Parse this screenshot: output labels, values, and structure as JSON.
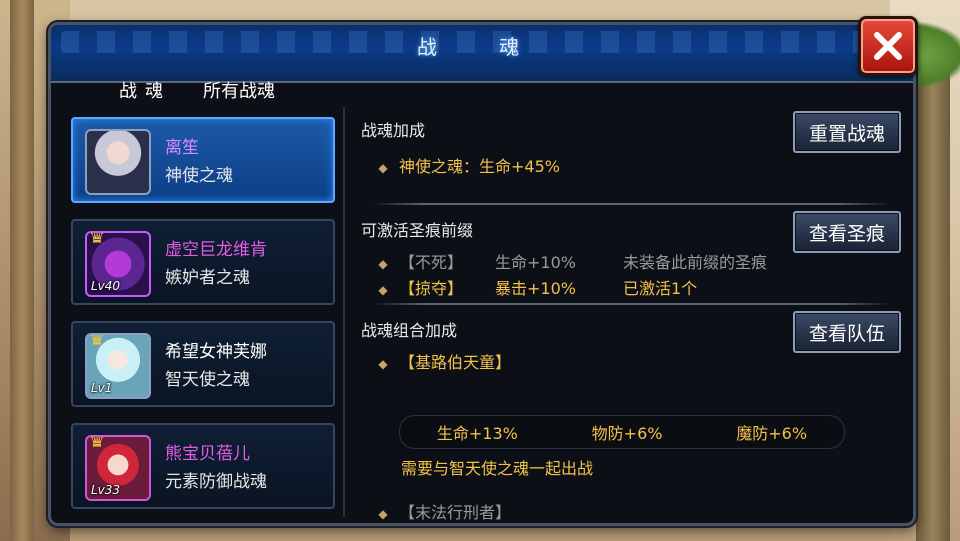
{
  "window": {
    "title": "战 魂"
  },
  "tabs": [
    {
      "label": "战魂",
      "active": true
    },
    {
      "label": "所有战魂",
      "active": false
    }
  ],
  "souls": [
    {
      "name": "离笙",
      "type": "神使之魂",
      "level": "",
      "name_color": "#d98bff",
      "selected": true,
      "crown": false
    },
    {
      "name": "虚空巨龙维肯",
      "type": "嫉妒者之魂",
      "level": "Lv40",
      "name_color": "#e25ce6",
      "selected": false,
      "crown": true
    },
    {
      "name": "希望女神芙娜",
      "type": "智天使之魂",
      "level": "Lv1",
      "name_color": "#ffffff",
      "selected": false,
      "crown": true
    },
    {
      "name": "熊宝贝蓓儿",
      "type": "元素防御战魂",
      "level": "Lv33",
      "name_color": "#e25ce6",
      "selected": false,
      "crown": true
    }
  ],
  "bonus": {
    "title": "战魂加成",
    "button": "重置战魂",
    "line": "神使之魂：生命+45%"
  },
  "prefix": {
    "title": "可激活圣痕前缀",
    "button": "查看圣痕",
    "rows": [
      {
        "name": "【不死】",
        "effect": "生命+10%",
        "status": "未装备此前缀的圣痕",
        "active": false
      },
      {
        "name": "【掠夺】",
        "effect": "暴击+10%",
        "status": "已激活1个",
        "active": true
      }
    ]
  },
  "combo": {
    "title": "战魂组合加成",
    "button": "查看队伍",
    "group1": "【基路伯天童】",
    "stats": [
      "生命+13%",
      "物防+6%",
      "魔防+6%"
    ],
    "requirement": "需要与智天使之魂一起出战",
    "group2": "【末法行刑者】"
  },
  "icons": {
    "close": "close-icon",
    "crown": "crown-icon",
    "bullet": "diamond-bullet-icon"
  },
  "colors": {
    "accent_blue": "#1c5aa8",
    "gold": "#f2c14a",
    "close_red": "#c8251a"
  }
}
